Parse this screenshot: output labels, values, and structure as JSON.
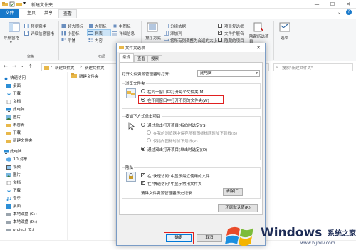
{
  "window": {
    "title": "新建文件夹",
    "minimize": "—",
    "maximize": "☐",
    "close": "✕"
  },
  "ribbon_tabs": [
    "文件",
    "主页",
    "共享",
    "查看"
  ],
  "ribbon": {
    "pane_group": {
      "nav_pane": "导航窗格",
      "preview_pane": "预览窗格",
      "details_pane": "详细信息窗格",
      "label": "窗格"
    },
    "layout_group": {
      "items": [
        "超大图标",
        "大图标",
        "中图标",
        "小图标",
        "列表",
        "详细信息",
        "平铺",
        "内容"
      ],
      "label": "布局"
    },
    "view_group": {
      "sort": "排序方式",
      "group_by": "分组依据",
      "add_column": "添加列",
      "fit_columns": "将所有列调整为合适的大小"
    },
    "show_group": {
      "checkbox": "项目复选框",
      "extensions": "文件扩展名",
      "hidden": "隐藏的项目",
      "hide_selected": "隐藏所选项目"
    },
    "options": "选项"
  },
  "address": {
    "path": [
      "新建文件夹",
      "新建文件夹"
    ],
    "search_placeholder": "搜索\"新建文件夹\""
  },
  "nav": {
    "quick_access": "快速访问",
    "items": [
      "桌面",
      "下载",
      "文档",
      "此电脑",
      "图片",
      "朱蓉青",
      "下载",
      "新建文件夹",
      "此电脑",
      "3D 对象",
      "视频",
      "图片",
      "文档",
      "下载",
      "音乐",
      "桌面",
      "本地磁盘 (C:)",
      "本地磁盘 (D:)",
      "project (E:)"
    ]
  },
  "content": {
    "folder_name": "新建文件夹"
  },
  "dialog": {
    "title": "文件夹选项",
    "close": "✕",
    "tabs": [
      "常规",
      "查看",
      "搜索"
    ],
    "open_in_label": "打开文件资源管理器时打开:",
    "open_in_value": "此电脑",
    "browse_group": "浏览文件夹",
    "browse_same": "在同一窗口中打开每个文件夹(M)",
    "browse_new": "在不同窗口中打开不同的文件夹(W)",
    "click_group": "按如下方式单击项目",
    "single_click": "通过单击打开项目(指向时选定)(S)",
    "underline_like_browser": "在我的浏览器中保存所有图标标题时加下划线(B)",
    "underline_on_hover": "仅指向图标时加下划线(P)",
    "double_click": "通过双击打开项目(单击时选定)(D)",
    "privacy_group": "隐私",
    "recent_files": "在\"快速访问\"中显示最近使用的文件",
    "frequent_folders": "在\"快速访问\"中显示常用文件夹",
    "clear_history": "清除文件资源管理器历史记录",
    "clear_button": "清除(C)",
    "restore_defaults": "还原默认值(R)",
    "ok": "确定",
    "cancel": "取消"
  },
  "watermark": {
    "brand": "Windows",
    "cn": "系统之家",
    "url": "www.bjjmlv.com"
  }
}
